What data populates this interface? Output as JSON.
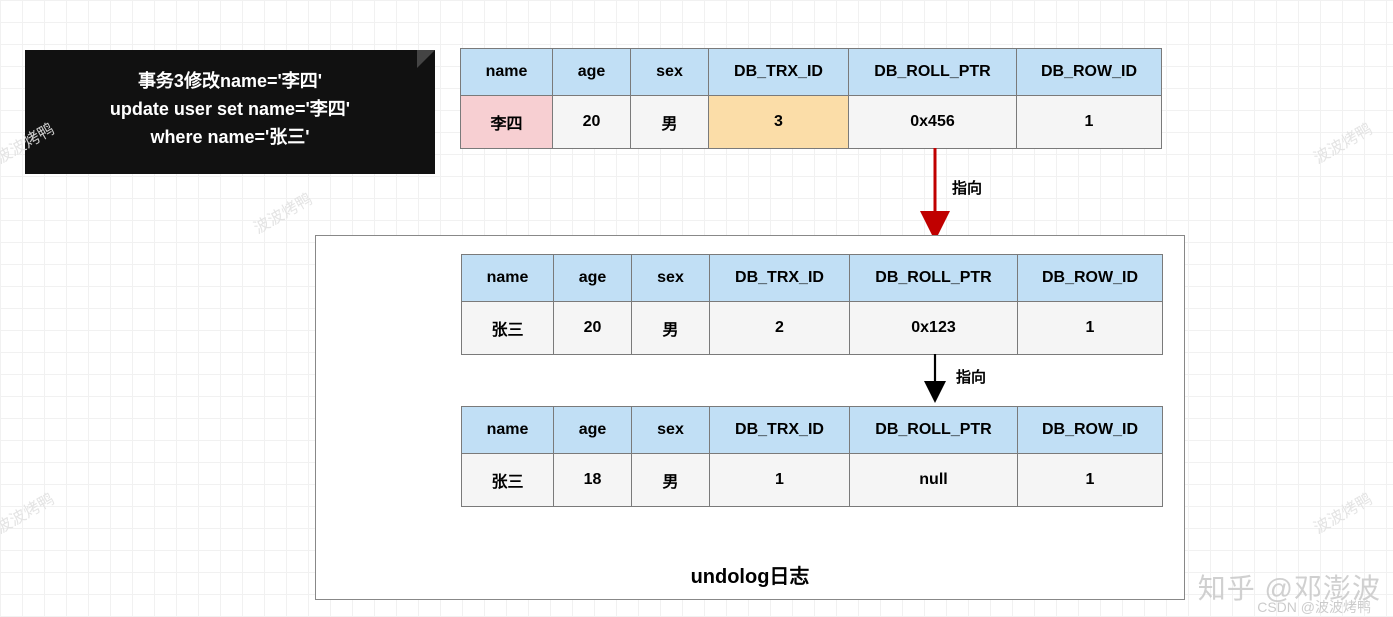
{
  "callout": {
    "line1": "事务3修改name='李四'",
    "line2": "update user set name='李四'",
    "line3": "where name='张三'"
  },
  "columns": {
    "name": "name",
    "age": "age",
    "sex": "sex",
    "trx": "DB_TRX_ID",
    "roll": "DB_ROLL_PTR",
    "row": "DB_ROW_ID"
  },
  "topRow": {
    "name": "李四",
    "age": "20",
    "sex": "男",
    "trx": "3",
    "roll": "0x456",
    "row": "1"
  },
  "undoRow1": {
    "name": "张三",
    "age": "20",
    "sex": "男",
    "trx": "2",
    "roll": "0x123",
    "row": "1"
  },
  "undoRow2": {
    "name": "张三",
    "age": "18",
    "sex": "男",
    "trx": "1",
    "roll": "null",
    "row": "1"
  },
  "labels": {
    "pointTo": "指向",
    "undologTitle": "undolog日志"
  },
  "watermarks": {
    "zhihu": "知乎 @邓澎波",
    "csdn": "CSDN @波波烤鸭",
    "side": "波波烤鸭"
  }
}
